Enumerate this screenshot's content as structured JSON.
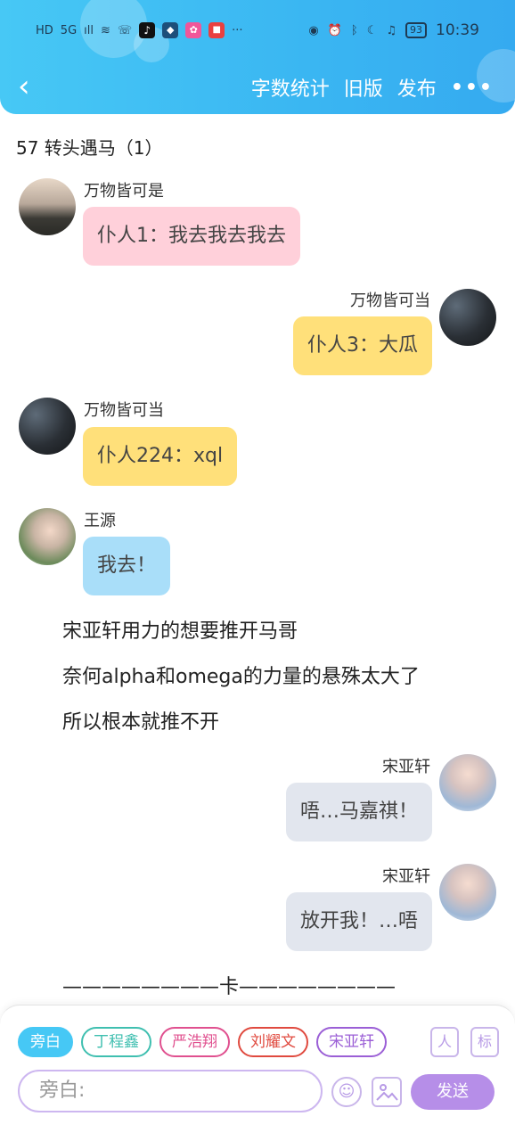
{
  "status_bar": {
    "left_labels": [
      "HD",
      "5G",
      "ıll",
      "≋",
      "☏",
      "♪",
      "◆",
      "✿",
      "■",
      "···"
    ],
    "right_icons": [
      "eye-icon",
      "alarm-icon",
      "bluetooth-icon",
      "moon-icon",
      "mute-icon"
    ],
    "battery": "93",
    "time": "10:39"
  },
  "header": {
    "back_glyph": "‹",
    "actions": [
      "字数统计",
      "旧版",
      "发布"
    ],
    "more_glyph": "•••"
  },
  "chapter_title": "57 转头遇马（1）",
  "messages": [
    {
      "name": "万物皆可是",
      "text": "仆人1：我去我去我去",
      "side": "left",
      "bubble_color": "#ffd0da"
    },
    {
      "name": "万物皆可当",
      "text": "仆人3：大瓜",
      "side": "right",
      "bubble_color": "#ffe07a"
    },
    {
      "name": "万物皆可当",
      "text": "仆人224：xql",
      "side": "left",
      "bubble_color": "#ffe07a"
    },
    {
      "name": "王源",
      "text": "我去！",
      "side": "left",
      "bubble_color": "#a9def9"
    }
  ],
  "narration": [
    "宋亚轩用力的想要推开马哥",
    "奈何alpha和omega的力量的悬殊太大了",
    "所以根本就推不开"
  ],
  "messages2": [
    {
      "name": "宋亚轩",
      "text": "唔…马嘉祺！",
      "side": "right",
      "bubble_color": "#e2e6ee"
    },
    {
      "name": "宋亚轩",
      "text": "放开我！…唔",
      "side": "right",
      "bubble_color": "#e2e6ee"
    }
  ],
  "divider_text": "————————卡————————",
  "composer": {
    "chips": [
      {
        "label": "旁白",
        "color": "#46c8f5",
        "active": true
      },
      {
        "label": "丁程鑫",
        "color": "#3fbfb0",
        "active": false
      },
      {
        "label": "严浩翔",
        "color": "#e0508f",
        "active": false
      },
      {
        "label": "刘耀文",
        "color": "#e04a3f",
        "active": false
      },
      {
        "label": "宋亚轩",
        "color": "#9b5fd6",
        "active": false
      }
    ],
    "role_icon_label": "人",
    "mark_button_label": "标",
    "input_placeholder": "旁白:",
    "emoji_glyph": "☺",
    "send_label": "发送"
  }
}
